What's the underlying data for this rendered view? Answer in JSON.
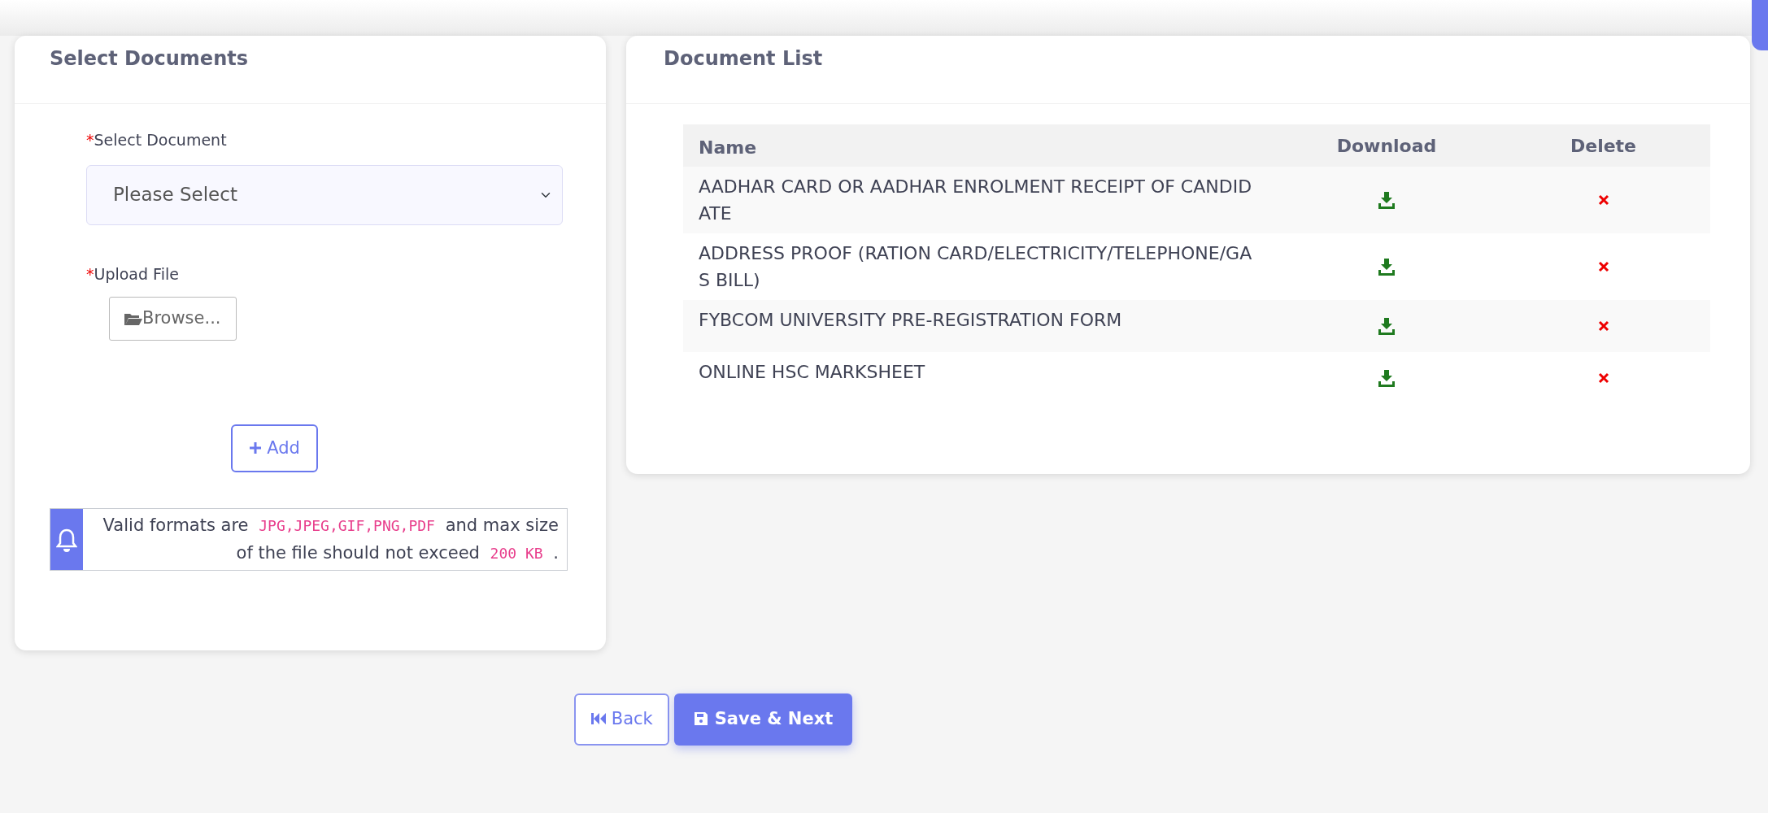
{
  "select_card": {
    "title": "Select Documents",
    "document_field": {
      "label": "Select Document",
      "required_mark": "*",
      "value": "Please Select"
    },
    "upload_field": {
      "label": "Upload File",
      "required_mark": "*",
      "button": "Browse..."
    },
    "add_button": "Add",
    "notice": [
      {
        "kind": "text",
        "text": "Valid formats are"
      },
      {
        "kind": "code",
        "text": "JPG,JPEG,GIF,PNG,PDF"
      },
      {
        "kind": "text",
        "text": "and max size of the file should not exceed"
      },
      {
        "kind": "code",
        "text": "200 KB"
      },
      {
        "kind": "text",
        "text": "."
      }
    ]
  },
  "list_card": {
    "title": "Document List",
    "table": {
      "columns": [
        "Name",
        "Download",
        "Delete"
      ],
      "rows": [
        {
          "name": "AADHAR CARD OR AADHAR ENROLMENT RECEIPT OF CANDIDATE"
        },
        {
          "name": "ADDRESS PROOF (RATION CARD/ELECTRICITY/TELEPHONE/GAS BILL)"
        },
        {
          "name": "FYBCOM UNIVERSITY PRE-REGISTRATION FORM"
        },
        {
          "name": "ONLINE HSC MARKSHEET"
        }
      ]
    }
  },
  "footer_buttons": [
    {
      "kind": "back",
      "label": "Back"
    },
    {
      "kind": "save",
      "label": "Save & Next"
    }
  ]
}
